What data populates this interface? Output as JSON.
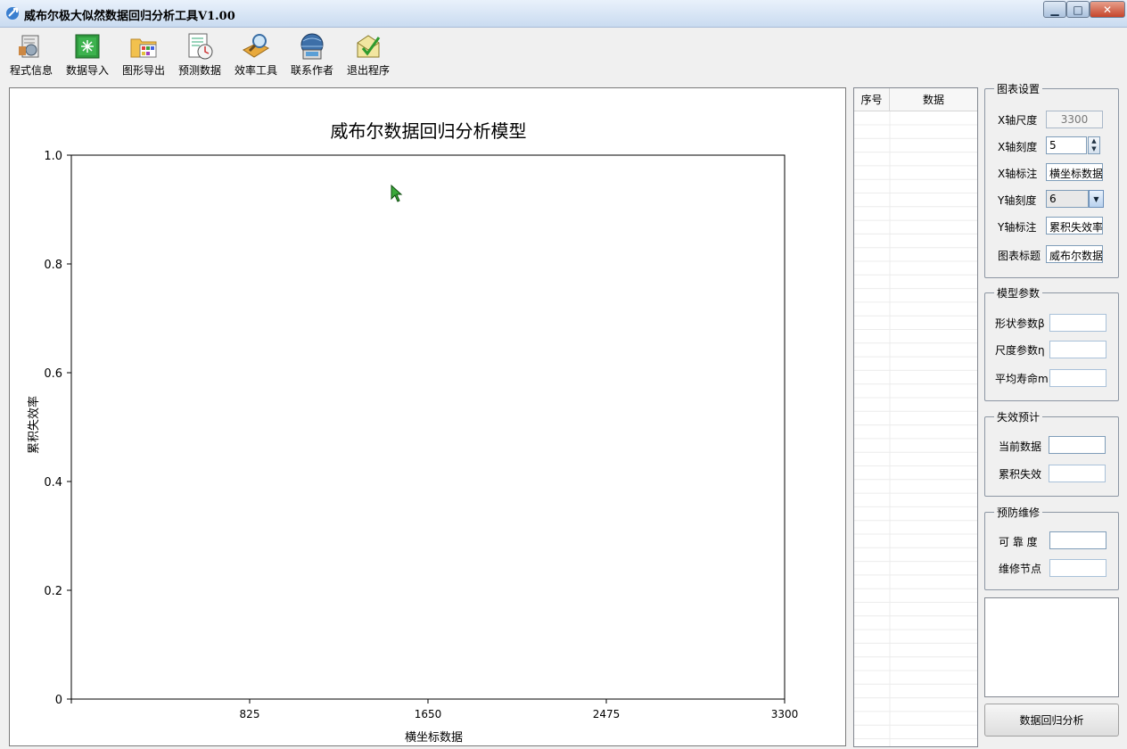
{
  "window": {
    "title": "威布尔极大似然数据回归分析工具V1.00",
    "min_glyph": "▁",
    "max_glyph": "□",
    "close_glyph": "✕"
  },
  "toolbar": [
    {
      "label": "程式信息",
      "icon": "program-info-icon"
    },
    {
      "label": "数据导入",
      "icon": "data-import-icon"
    },
    {
      "label": "图形导出",
      "icon": "chart-export-icon"
    },
    {
      "label": "预测数据",
      "icon": "forecast-data-icon"
    },
    {
      "label": "效率工具",
      "icon": "efficiency-tools-icon"
    },
    {
      "label": "联系作者",
      "icon": "contact-author-icon"
    },
    {
      "label": "退出程序",
      "icon": "exit-program-icon"
    }
  ],
  "chart_data": {
    "type": "line",
    "title": "威布尔数据回归分析模型",
    "xlabel": "横坐标数据",
    "ylabel": "累积失效率",
    "xlim": [
      0,
      3300
    ],
    "ylim": [
      0,
      1.0
    ],
    "xticks": [
      825,
      1650,
      2475,
      3300
    ],
    "xtick_labels": [
      "825",
      "1650",
      "2475",
      "3300"
    ],
    "yticks": [
      0,
      0.2,
      0.4,
      0.6,
      0.8,
      1.0
    ],
    "ytick_labels": [
      "0",
      "0.2",
      "0.4",
      "0.6",
      "0.8",
      "1.0"
    ],
    "series": []
  },
  "table": {
    "col_index": "序号",
    "col_data": "数据",
    "rows": []
  },
  "chart_settings": {
    "title": "图表设置",
    "x_scale_label": "X轴尺度",
    "x_scale_value": "3300",
    "x_ticks_label": "X轴刻度",
    "x_ticks_value": "5",
    "x_caption_label": "X轴标注",
    "x_caption_value": "横坐标数据",
    "y_ticks_label": "Y轴刻度",
    "y_ticks_value": "6",
    "y_caption_label": "Y轴标注",
    "y_caption_value": "累积失效率",
    "chart_title_label": "图表标题",
    "chart_title_value": "威布尔数据"
  },
  "model_params": {
    "title": "模型参数",
    "shape_label": "形状参数β",
    "shape_value": "",
    "scale_label": "尺度参数η",
    "scale_value": "",
    "mean_life_label": "平均寿命m",
    "mean_life_value": ""
  },
  "failure_forecast": {
    "title": "失效预计",
    "current_label": "当前数据",
    "current_value": "",
    "cumulative_label": "累积失效",
    "cumulative_value": ""
  },
  "maintenance": {
    "title": "预防维修",
    "reliability_label": "可 靠 度",
    "reliability_value": "",
    "node_label": "维修节点",
    "node_value": ""
  },
  "analyze_button": "数据回归分析"
}
